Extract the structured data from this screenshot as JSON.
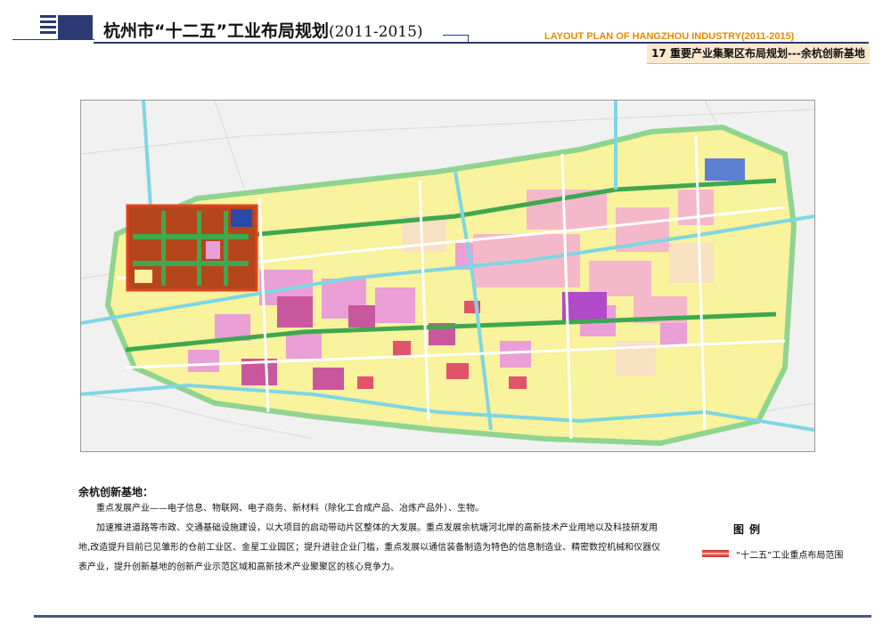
{
  "header": {
    "title_zh": "杭州市“十二五”工业布局规划",
    "title_years": "(2011-2015)",
    "title_en": "LAYOUT PLAN OF HANGZHOU INDUSTRY(2011-2015)",
    "subtitle": "17 重要产业集聚区布局规划---余杭创新基地"
  },
  "map": {
    "base_colors": {
      "background": "#f4f4f4",
      "water": "#7fd6e3",
      "green": "#3ea84f",
      "residential": "#f7f39a",
      "commercial": "#e89ad8",
      "industrial": "#f4b6c9",
      "education": "#d66aa8",
      "road": "#ffffff",
      "highlight_border": "#e2421f",
      "highlight_fill": "#b5461c"
    },
    "compass": "north-arrow-icon"
  },
  "description": {
    "heading": "余杭创新基地：",
    "paragraph1": "重点发展产业——电子信息、物联网、电子商务、新材料（除化工合成产品、冶炼产品外）、生物。",
    "paragraph2": "加速推进道路等市政、交通基础设施建设，以大项目的启动带动片区整体的大发展。重点发展余杭塘河北岸的高新技术产业用地以及科技研发用地,改造提升目前已见雏形的仓前工业区、金星工业园区；提升进驻企业门槛，重点发展以通信装备制造为特色的信息制造业、精密数控机械和仪器仪表产业，提升创新基地的创新产业示范区域和高新技术产业聚聚区的核心竞争力。"
  },
  "legend": {
    "title": "图例",
    "item_label": "“十二五”工业重点布局范围",
    "item_color": "#e74c3c"
  }
}
